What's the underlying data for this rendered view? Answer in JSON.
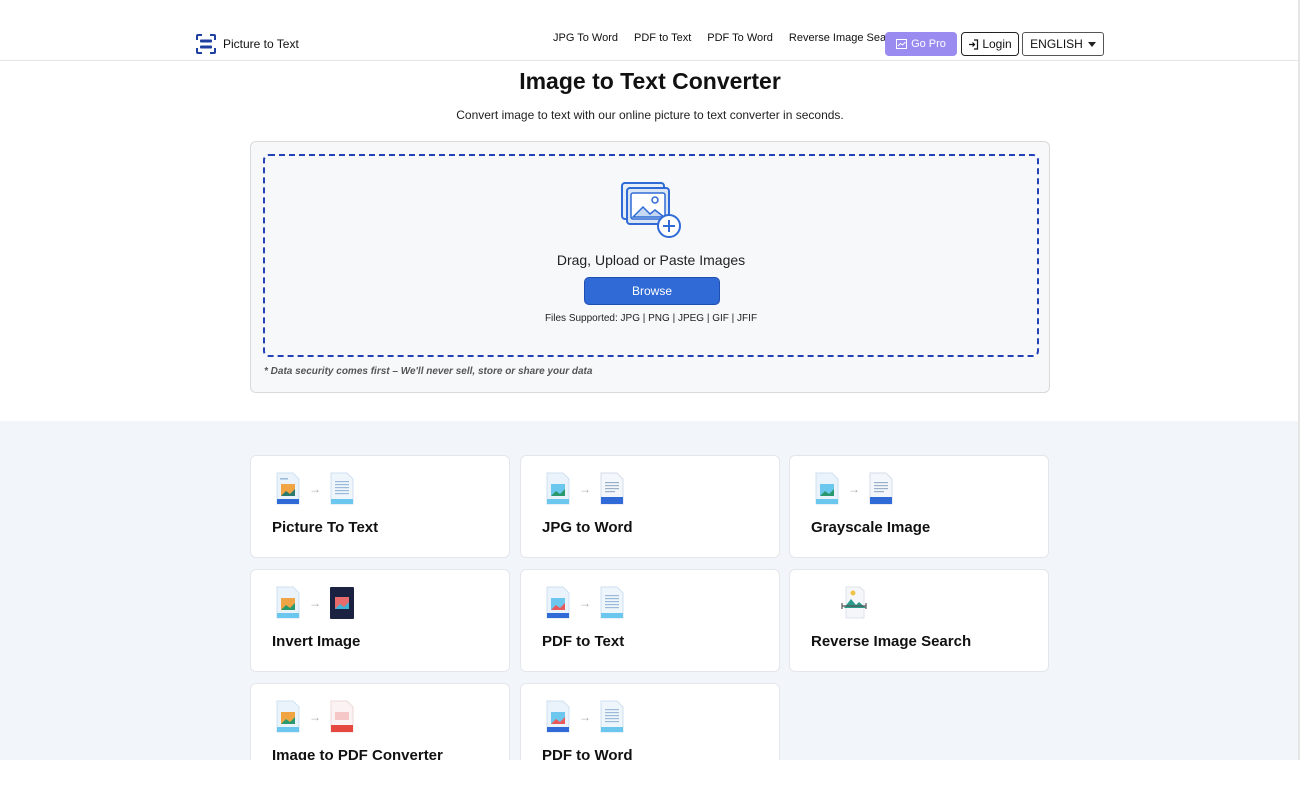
{
  "header": {
    "logo_text": "Picture to Text",
    "nav": [
      "JPG To Word",
      "PDF to Text",
      "PDF To Word",
      "Reverse Image Search"
    ],
    "gopro_label": "Go Pro",
    "login_label": "Login",
    "language": "ENGLISH"
  },
  "hero": {
    "title": "Image to Text Converter",
    "subtitle": "Convert image to text with our online picture to text converter in seconds."
  },
  "upload": {
    "drag_text": "Drag, Upload or Paste Images",
    "browse_label": "Browse",
    "supported": "Files Supported: JPG | PNG | JPEG | GIF | JFIF",
    "security_note": "* Data security comes first – We'll never sell, store or share your data"
  },
  "tools": [
    {
      "name": "Picture To Text",
      "from": "JPG",
      "to": "TXT"
    },
    {
      "name": "JPG to Word",
      "from": "JPG",
      "to": "DOC"
    },
    {
      "name": "Grayscale Image",
      "from": "JPG",
      "to": "DOC"
    },
    {
      "name": "Invert Image",
      "from": "",
      "to": ""
    },
    {
      "name": "PDF to Text",
      "from": "",
      "to": "TXT"
    },
    {
      "name": "Reverse Image Search",
      "from": "",
      "to": ""
    },
    {
      "name": "Image to PDF Converter",
      "from": "JPG",
      "to": "PDF"
    },
    {
      "name": "PDF to Word",
      "from": "",
      "to": "TXT"
    }
  ],
  "colors": {
    "accent": "#2f6ad6",
    "dashed_border": "#2342b8",
    "gopro": "#9a8bf0",
    "section_bg": "#f2f5fa"
  }
}
